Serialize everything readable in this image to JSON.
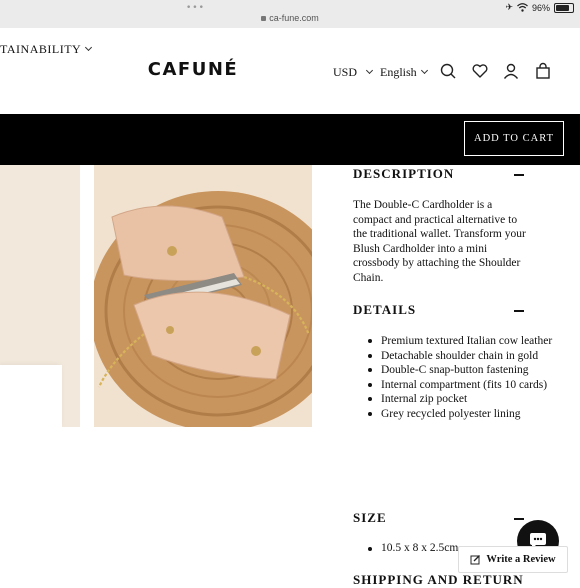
{
  "browser": {
    "url": "ca-fune.com",
    "battery": "96%",
    "battery_level": 0.96
  },
  "header": {
    "nav_left": "TAINABILITY",
    "logo": "CAFUNÉ",
    "currency": "USD",
    "language": "English",
    "icons": [
      "search-icon",
      "heart-icon",
      "user-icon",
      "bag-icon"
    ]
  },
  "cart": {
    "button_label": "ADD TO CART"
  },
  "description": {
    "title": "DESCRIPTION",
    "text": "The Double-C Cardholder is a compact and practical alternative to the traditional wallet. Transform your Blush Cardholder into a mini crossbody by attaching the Shoulder Chain."
  },
  "details": {
    "title": "DETAILS",
    "items": [
      "Premium textured Italian cow leather",
      "Detachable shoulder chain in gold",
      "Double-C snap-button fastening",
      "Internal compartment (fits 10 cards)",
      "Internal zip pocket",
      "Grey recycled polyester lining"
    ]
  },
  "size": {
    "title": "SIZE",
    "value": "10.5 x 8 x 2.5cm"
  },
  "shipping": {
    "title": "SHIPPING AND RETURN"
  },
  "widget": {
    "review_label": "Write a Review"
  },
  "colors": {
    "cart_bar": "#000000",
    "image_bg_left": "#f2e8db",
    "image_bg_right": "#f1e2cf",
    "wood": "#c9955f",
    "leather": "#e9c2a6"
  }
}
